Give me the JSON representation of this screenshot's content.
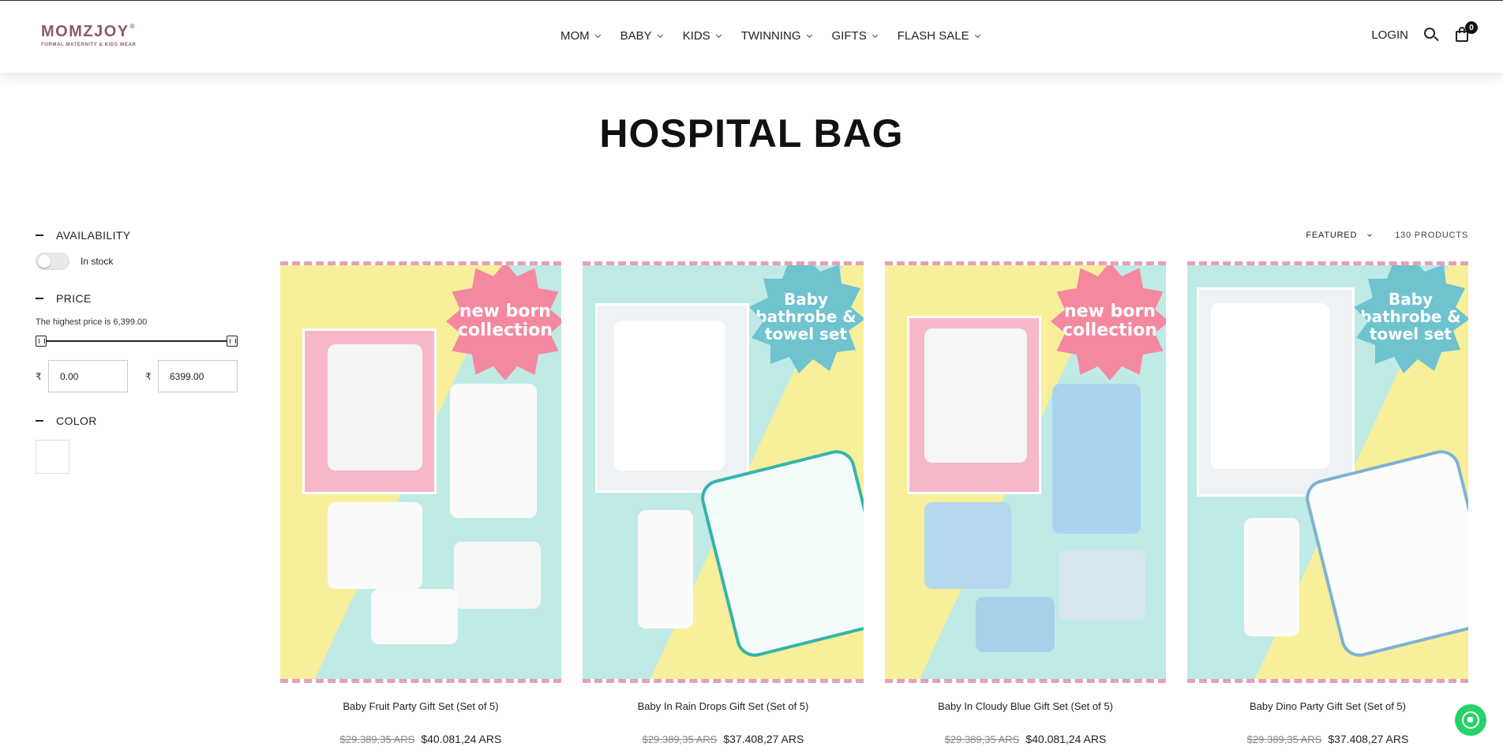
{
  "brand": {
    "name": "MOMZJOY",
    "tagline": "FORMAL MATERNITY & KIDS WEAR"
  },
  "nav": [
    {
      "label": "MOM"
    },
    {
      "label": "BABY"
    },
    {
      "label": "KIDS"
    },
    {
      "label": "TWINNING"
    },
    {
      "label": "GIFTS"
    },
    {
      "label": "FLASH SALE"
    }
  ],
  "header": {
    "login_label": "LOGIN",
    "cart_count": "0"
  },
  "page": {
    "title": "HOSPITAL BAG"
  },
  "filters": {
    "availability_label": "AVAILABILITY",
    "in_stock_label": "In stock",
    "in_stock_enabled": false,
    "price_label": "PRICE",
    "highest_price_note": "The highest price is 6,399.00",
    "currency_symbol": "₹",
    "min_value": "0.00",
    "max_value": "6399.00",
    "color_label": "COLOR"
  },
  "toolbar": {
    "sort_label": "FEATURED",
    "product_count": "130 PRODUCTS"
  },
  "products": [
    {
      "name": "Baby Fruit Party Gift Set (Set of 5)",
      "old_price": "$29.389,35 ARS",
      "price": "$40.081,24 ARS",
      "badge": "new born collection",
      "accent": "#f4889f"
    },
    {
      "name": "Baby In Rain Drops Gift Set (Set of 5)",
      "old_price": "$29.389,35 ARS",
      "price": "$37.408,27 ARS",
      "badge": "Baby bathrobe & towel set",
      "accent": "#6ec3cf"
    },
    {
      "name": "Baby In Cloudy Blue Gift Set (Set of 5)",
      "old_price": "$29.389,35 ARS",
      "price": "$40.081,24 ARS",
      "badge": "new born collection",
      "accent": "#f4889f"
    },
    {
      "name": "Baby Dino Party Gift Set (Set of 5)",
      "old_price": "$29.389,35 ARS",
      "price": "$37.408,27 ARS",
      "badge": "Baby bathrobe & towel set",
      "accent": "#6ec3cf"
    }
  ],
  "colors": {
    "pastel_yellow": "#f8ef9a",
    "pastel_mint": "#bfeae6",
    "pink": "#f4889f",
    "teal": "#6ec3cf",
    "whatsapp": "#25d366"
  }
}
